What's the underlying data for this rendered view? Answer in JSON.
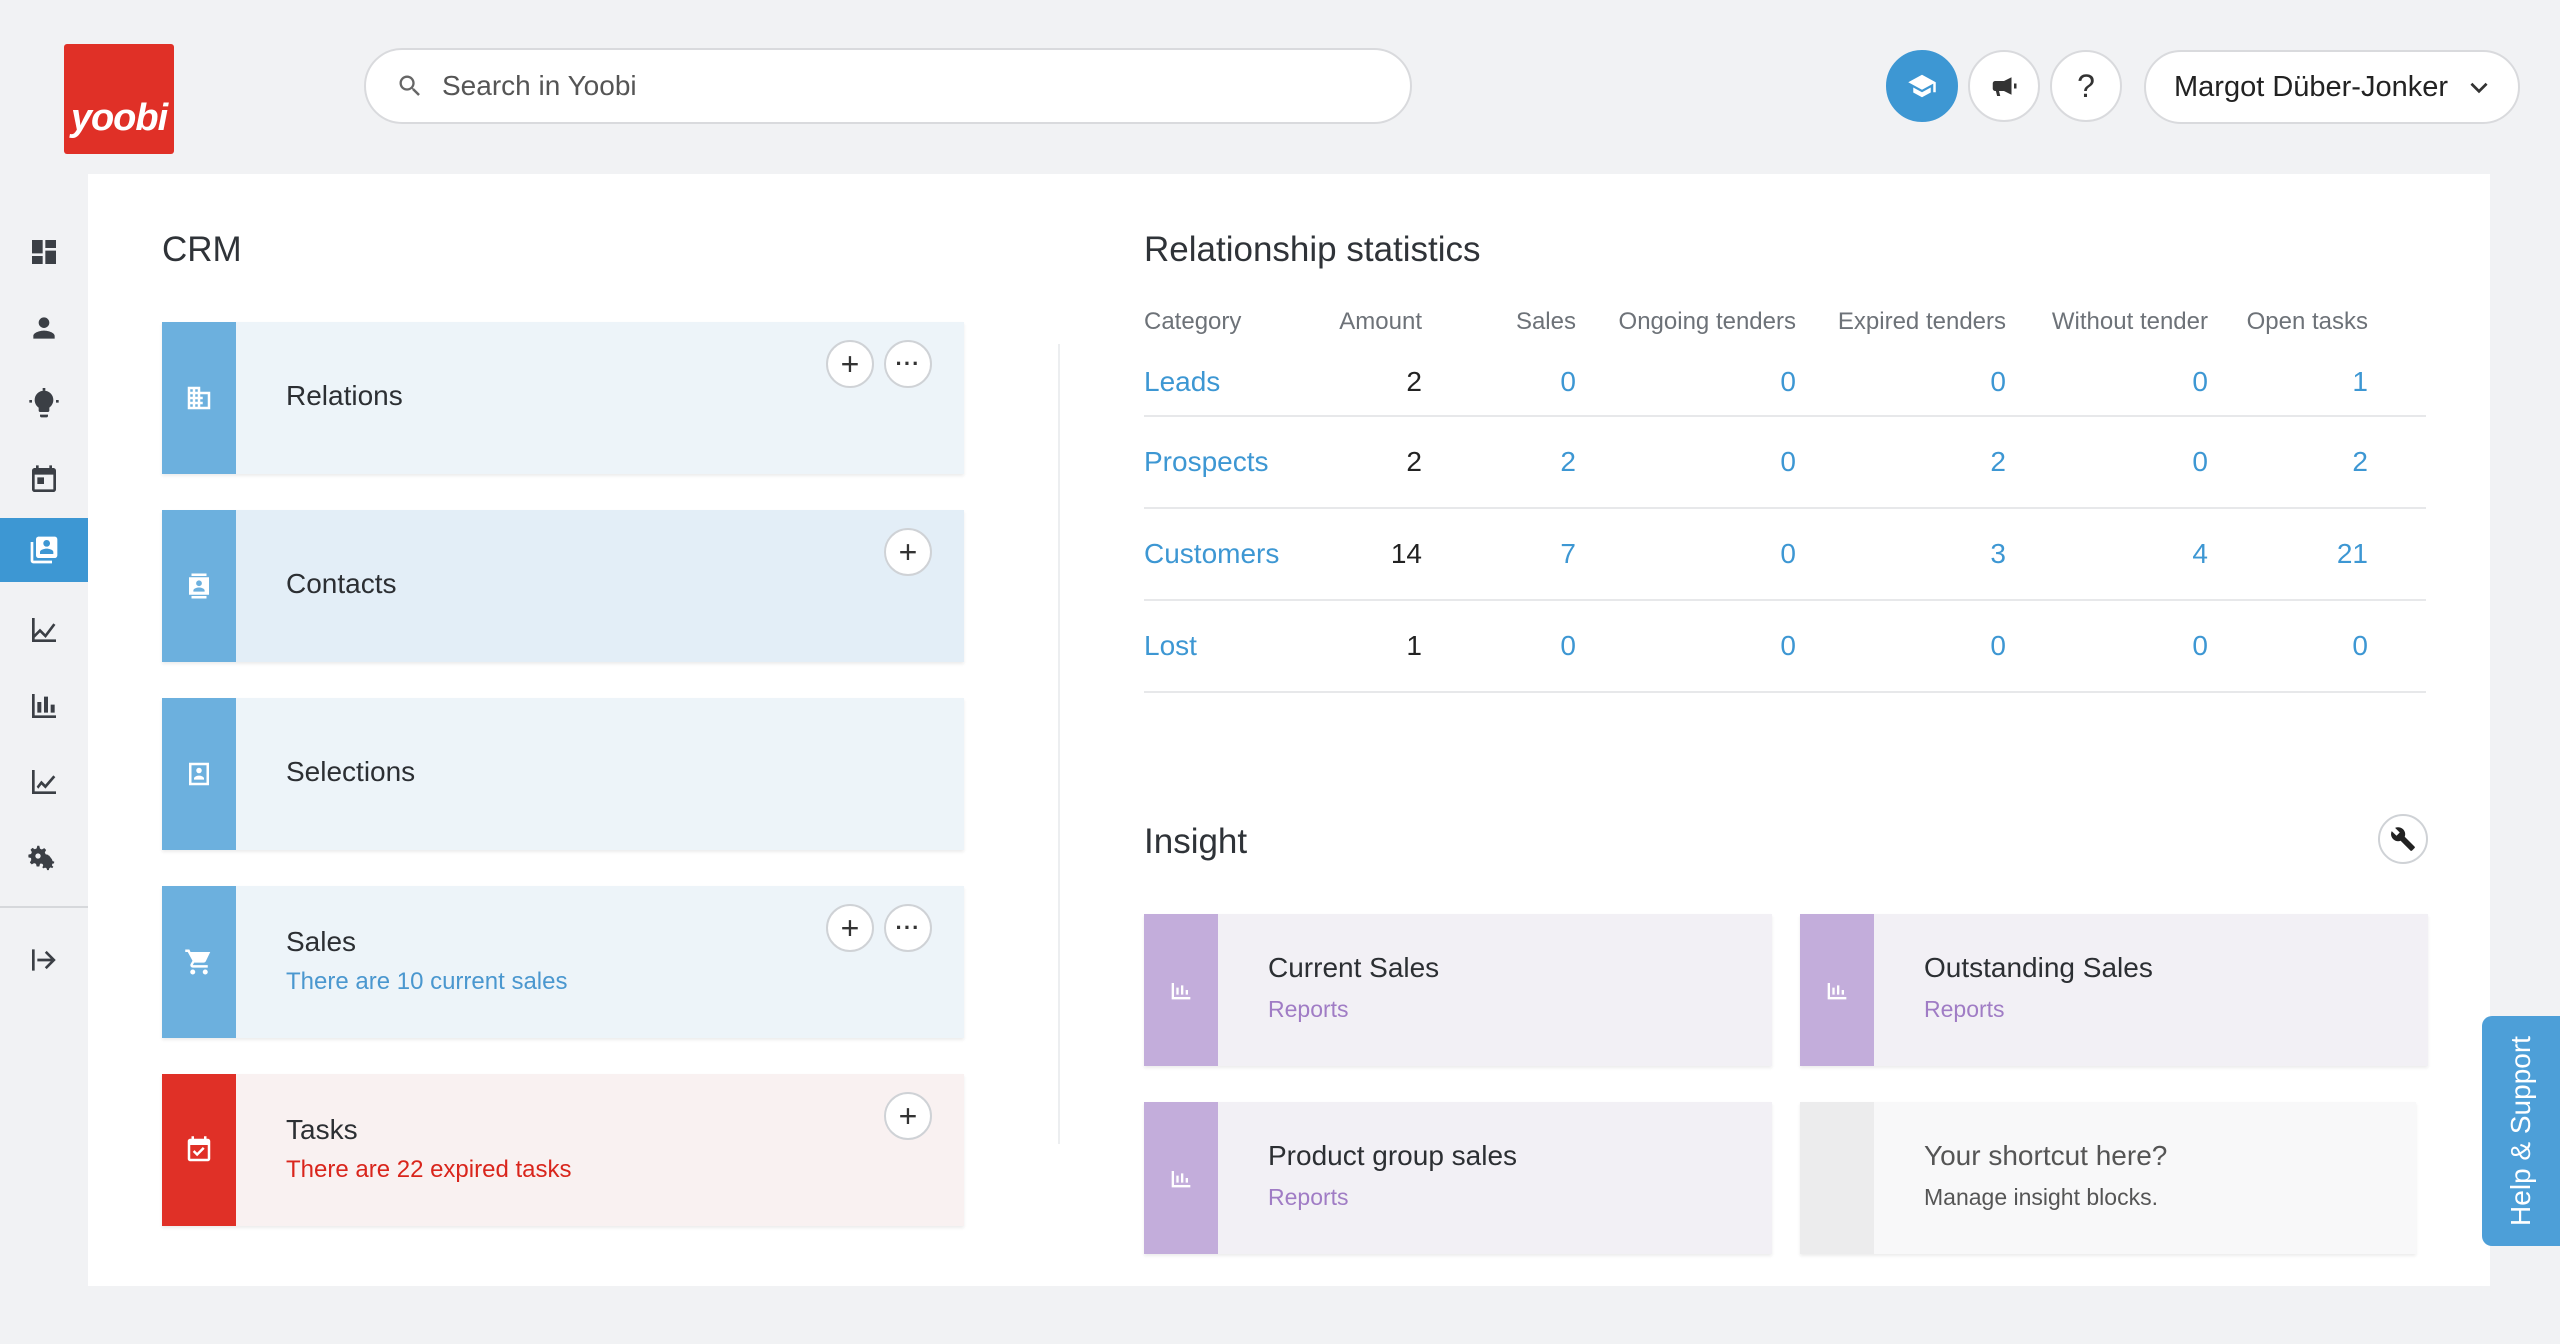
{
  "brand": {
    "logo_text": "yoobi",
    "color": "#e03027"
  },
  "search": {
    "placeholder": "Search in Yoobi"
  },
  "header": {
    "user_name": "Margot Düber-Jonker",
    "help_label": "?"
  },
  "sidebar": {
    "items": [
      {
        "icon": "dashboard-icon"
      },
      {
        "icon": "person-icon"
      },
      {
        "icon": "lightbulb-icon"
      },
      {
        "icon": "calendar-icon"
      },
      {
        "icon": "crm-icon",
        "active": true
      },
      {
        "icon": "trend-chart-icon"
      },
      {
        "icon": "bar-chart-icon"
      },
      {
        "icon": "line-chart-icon"
      },
      {
        "icon": "settings-icon"
      },
      {
        "icon": "logout-icon"
      }
    ]
  },
  "crm": {
    "title": "CRM",
    "cards": [
      {
        "title": "Relations",
        "subtitle": ""
      },
      {
        "title": "Contacts",
        "subtitle": ""
      },
      {
        "title": "Selections",
        "subtitle": ""
      },
      {
        "title": "Sales",
        "subtitle": "There are 10 current sales"
      },
      {
        "title": "Tasks",
        "subtitle": "There are 22 expired tasks"
      }
    ],
    "add_label": "+",
    "more_label": "···"
  },
  "stats": {
    "title": "Relationship statistics",
    "columns": [
      "Category",
      "Amount",
      "Sales",
      "Ongoing tenders",
      "Expired tenders",
      "Without tender",
      "Open tasks"
    ],
    "rows": [
      {
        "category": "Leads",
        "amount": "2",
        "sales": "0",
        "ongoing": "0",
        "expired": "0",
        "without": "0",
        "tasks": "1"
      },
      {
        "category": "Prospects",
        "amount": "2",
        "sales": "2",
        "ongoing": "0",
        "expired": "2",
        "without": "0",
        "tasks": "2"
      },
      {
        "category": "Customers",
        "amount": "14",
        "sales": "7",
        "ongoing": "0",
        "expired": "3",
        "without": "4",
        "tasks": "21"
      },
      {
        "category": "Lost",
        "amount": "1",
        "sales": "0",
        "ongoing": "0",
        "expired": "0",
        "without": "0",
        "tasks": "0"
      }
    ]
  },
  "insight": {
    "title": "Insight",
    "cards": [
      {
        "title": "Current Sales",
        "subtitle": "Reports"
      },
      {
        "title": "Outstanding Sales",
        "subtitle": "Reports"
      },
      {
        "title": "Product group sales",
        "subtitle": "Reports"
      },
      {
        "title": "Your shortcut here?",
        "subtitle": "Manage insight blocks."
      }
    ]
  },
  "help_tab": {
    "label": "Help & Support"
  }
}
